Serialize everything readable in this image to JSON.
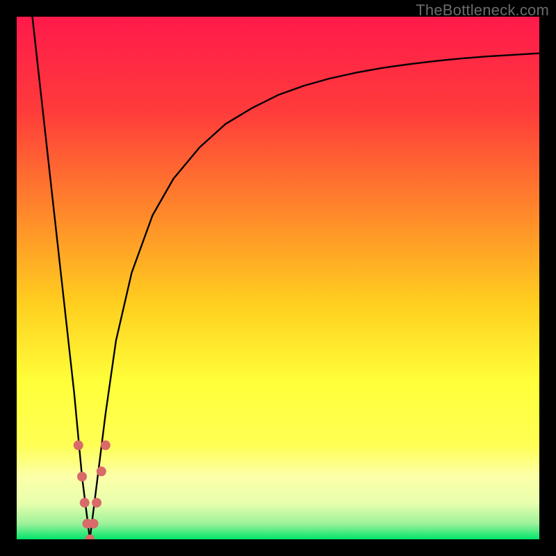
{
  "watermark": "TheBottleneck.com",
  "colors": {
    "gradient_top": "#ff1a4b",
    "gradient_mid1": "#ff7a2a",
    "gradient_mid2": "#ffe21a",
    "gradient_mid3": "#ffff4d",
    "gradient_band": "#fcffb0",
    "gradient_bottom": "#00e56a",
    "curve": "#000000",
    "marker_fill": "#d86a6a",
    "marker_stroke": "#b54f4f"
  },
  "chart_data": {
    "type": "line",
    "x": [
      0.0,
      0.02,
      0.04,
      0.06,
      0.08,
      0.1,
      0.12,
      0.14,
      0.16,
      0.18,
      0.2,
      0.22,
      0.24,
      0.26,
      0.28,
      0.3,
      0.35,
      0.4,
      0.45,
      0.5,
      0.55,
      0.6,
      0.65,
      0.7,
      0.75,
      0.8,
      0.85,
      0.9,
      0.95,
      1.0
    ],
    "series": [
      {
        "name": "left-branch",
        "x": [
          0.03,
          0.05,
          0.07,
          0.09,
          0.11,
          0.125,
          0.135,
          0.14
        ],
        "y": [
          100,
          82,
          64,
          46,
          28,
          12,
          4,
          0
        ]
      },
      {
        "name": "right-branch",
        "x": [
          0.14,
          0.145,
          0.155,
          0.17,
          0.19,
          0.22,
          0.26,
          0.3,
          0.35,
          0.4,
          0.45,
          0.5,
          0.55,
          0.6,
          0.65,
          0.7,
          0.75,
          0.8,
          0.85,
          0.9,
          0.95,
          1.0
        ],
        "y": [
          0,
          4,
          12,
          24,
          38,
          51,
          62,
          69,
          75,
          79.5,
          82.5,
          85,
          86.8,
          88.2,
          89.3,
          90.2,
          90.9,
          91.5,
          92,
          92.4,
          92.7,
          93
        ]
      }
    ],
    "markers": [
      {
        "x": 0.118,
        "y": 18,
        "r": 7
      },
      {
        "x": 0.125,
        "y": 12,
        "r": 7
      },
      {
        "x": 0.13,
        "y": 7,
        "r": 7
      },
      {
        "x": 0.135,
        "y": 3,
        "r": 7
      },
      {
        "x": 0.14,
        "y": 0,
        "r": 7
      },
      {
        "x": 0.147,
        "y": 3,
        "r": 7
      },
      {
        "x": 0.153,
        "y": 7,
        "r": 7
      },
      {
        "x": 0.162,
        "y": 13,
        "r": 7
      },
      {
        "x": 0.17,
        "y": 18,
        "r": 7
      }
    ],
    "title": "",
    "xlabel": "",
    "ylabel": "",
    "xlim": [
      0,
      1
    ],
    "ylim": [
      0,
      100
    ]
  }
}
